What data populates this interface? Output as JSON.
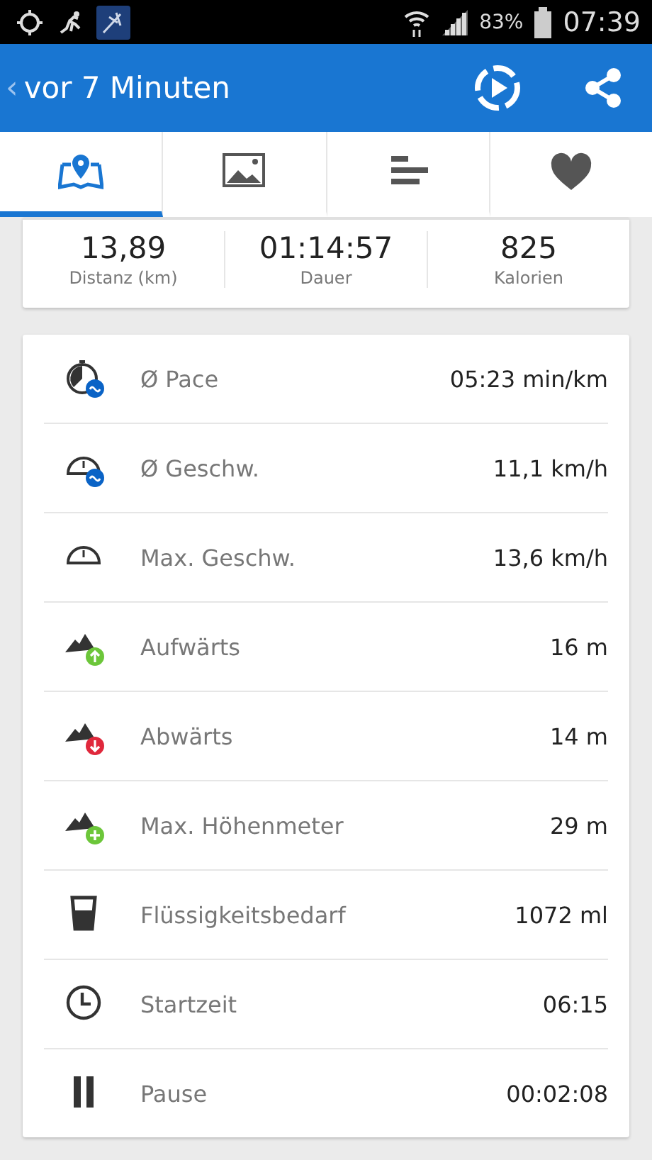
{
  "status_bar": {
    "battery": "83%",
    "time": "07:39"
  },
  "app_bar": {
    "back": "‹",
    "title": "vor 7 Minuten"
  },
  "tabs": [
    {
      "kind": "map",
      "selected": true
    },
    {
      "kind": "image",
      "selected": false
    },
    {
      "kind": "bars",
      "selected": false
    },
    {
      "kind": "heart",
      "selected": false
    }
  ],
  "summary": [
    {
      "value": "13,89",
      "label": "Distanz (km)"
    },
    {
      "value": "01:14:57",
      "label": "Dauer"
    },
    {
      "value": "825",
      "label": "Kalorien"
    }
  ],
  "metrics": [
    {
      "kind": "pace",
      "label": "Ø Pace",
      "value": "05:23 min/km"
    },
    {
      "kind": "avg-speed",
      "label": "Ø Geschw.",
      "value": "11,1 km/h"
    },
    {
      "kind": "max-speed",
      "label": "Max. Geschw.",
      "value": "13,6 km/h"
    },
    {
      "kind": "ascent",
      "label": "Aufwärts",
      "value": "16 m"
    },
    {
      "kind": "descent",
      "label": "Abwärts",
      "value": "14 m"
    },
    {
      "kind": "max-altitude",
      "label": "Max. Höhenmeter",
      "value": "29 m"
    },
    {
      "kind": "water",
      "label": "Flüssigkeitsbedarf",
      "value": "1072 ml"
    },
    {
      "kind": "clock",
      "label": "Startzeit",
      "value": "06:15"
    },
    {
      "kind": "pause",
      "label": "Pause",
      "value": "00:02:08"
    }
  ]
}
